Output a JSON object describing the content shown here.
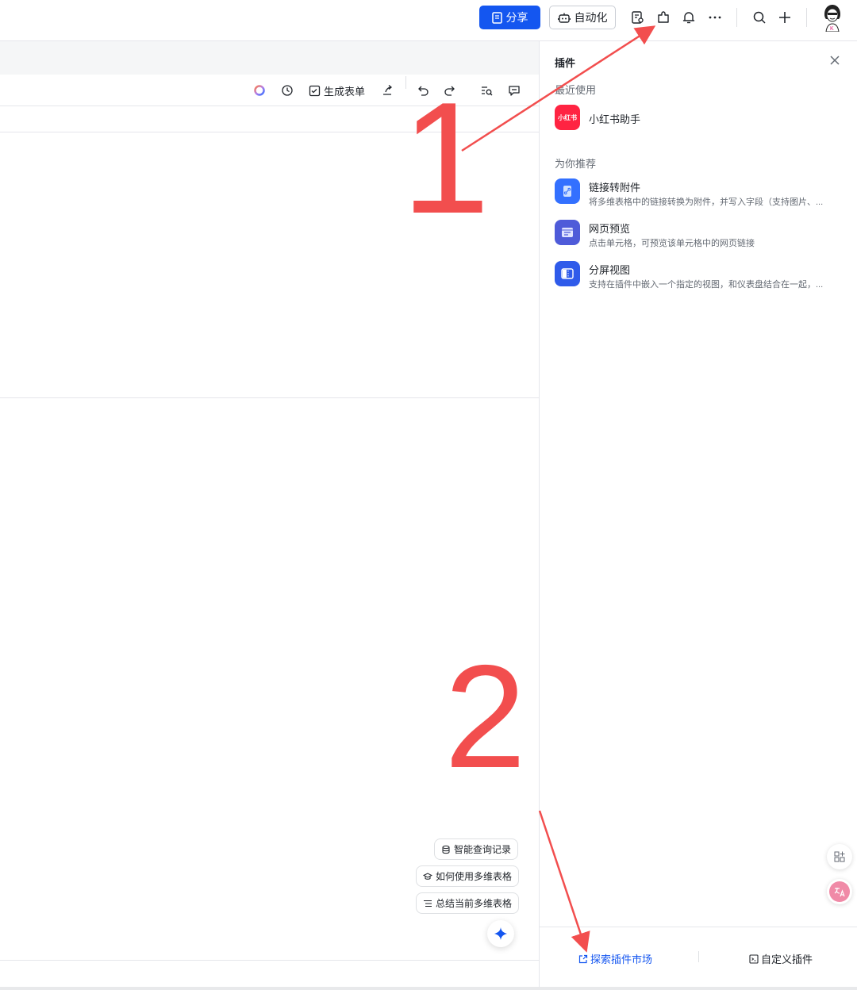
{
  "topbar": {
    "share_label": "分享",
    "automation_label": "自动化",
    "icons": [
      "doc-search-icon",
      "plugin-icon",
      "bell-icon",
      "more-icon",
      "search-icon",
      "plus-icon"
    ]
  },
  "toolbar": {
    "generate_form_label": "生成表单"
  },
  "chips": {
    "smart_query": "智能查询记录",
    "how_to_use": "如何使用多维表格",
    "summarize": "总结当前多维表格"
  },
  "panel": {
    "title": "插件",
    "recent_title": "最近使用",
    "recent_items": [
      {
        "name": "小红书助手",
        "icon_text": "小红书",
        "color": "#ff2442"
      }
    ],
    "recommend_title": "为你推荐",
    "recommend_items": [
      {
        "name": "链接转附件",
        "desc": "将多维表格中的链接转换为附件，并写入字段（支持图片、...",
        "color": "#3370ff"
      },
      {
        "name": "网页预览",
        "desc": "点击单元格，可预览该单元格中的网页链接",
        "color": "#4e5bd9"
      },
      {
        "name": "分屏视图",
        "desc": "支持在插件中嵌入一个指定的视图，和仪表盘结合在一起，...",
        "color": "#2f5bea"
      }
    ],
    "footer": {
      "explore_label": "探索插件市场",
      "custom_label": "自定义插件"
    }
  },
  "annotations": {
    "one": "1",
    "two": "2",
    "color": "#f24e4e"
  }
}
